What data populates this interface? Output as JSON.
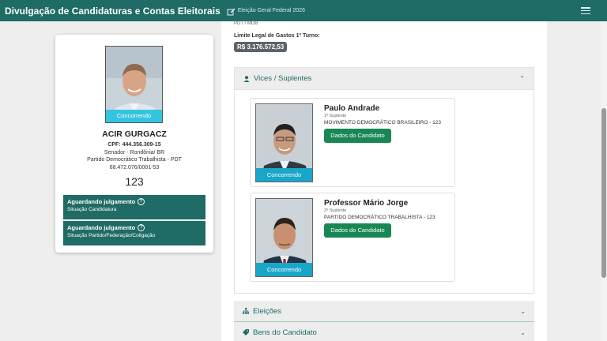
{
  "header": {
    "title": "Divulgação de Candidaturas e Contas Eleitorais",
    "election": "Eleição Geral Federal 2026"
  },
  "candidate": {
    "photo_label": "Concorrendo",
    "name": "ACIR GURGACZ",
    "cpf": "CPF: 444.356.309-15",
    "cargo": "Senador - Rondônia/ BR",
    "party": "Partido Democrático Trabalhista - PDT",
    "cnpj": "68.472.076/0001-53",
    "number": "123",
    "status": [
      {
        "title": "Aguardando julgamento",
        "subtitle": "Situação Candidatura"
      },
      {
        "title": "Aguardando julgamento",
        "subtitle": "Situação Partido/Federação/Coligação"
      }
    ]
  },
  "main": {
    "coalition": "PDT / MDB",
    "limit_label": "Limite Legal de Gastos 1º Turno:",
    "limit_value": "R$ 3.176.572,53",
    "sections": {
      "vices": "Vices / Suplentes",
      "eleicoes": "Eleições",
      "bens": "Bens do Candidato"
    },
    "suplentes": [
      {
        "name": "Paulo Andrade",
        "order": "1º Suplente",
        "party": "MOVIMENTO DEMOCRÁTICO BRASILEIRO - 123",
        "photo_label": "Concorrendo",
        "button": "Dados do Candidato"
      },
      {
        "name": "Professor Mário Jorge",
        "order": "2º Suplente",
        "party": "PARTIDO DEMOCRÁTICO TRABALHISTA - 123",
        "photo_label": "Concorrendo",
        "button": "Dados do Candidato"
      }
    ]
  },
  "colors": {
    "brand": "#1f6b66",
    "button": "#198754",
    "photo_badge": "#33c4e0"
  }
}
